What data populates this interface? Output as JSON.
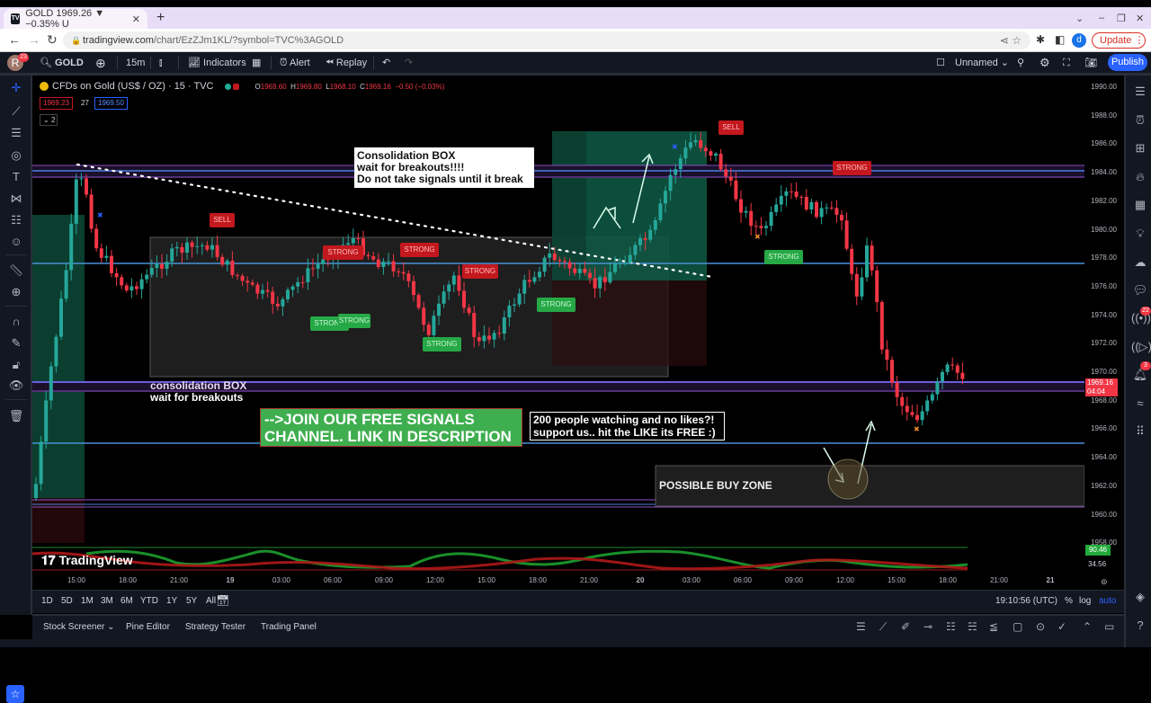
{
  "browser": {
    "tab_title": "GOLD 1969.26 ▼ −0.35% U",
    "tab_favicon": "TV",
    "url_domain": "tradingview.com",
    "url_path": "/chart/EzZJm1KL/?symbol=TVC%3AGOLD",
    "profile_initial": "d",
    "update_label": "Update"
  },
  "toolbar": {
    "avatar_initial": "R",
    "avatar_badge": "23",
    "symbol": "GOLD",
    "interval": "15m",
    "indicators_label": "Indicators",
    "alert_label": "Alert",
    "replay_label": "Replay",
    "layout_name": "Unnamed",
    "publish_label": "Publish"
  },
  "legend": {
    "title": "CFDs on Gold (US$ / OZ) · 15 · TVC",
    "open_label": "O",
    "open": "1969.60",
    "high_label": "H",
    "high": "1969.80",
    "low_label": "L",
    "low": "1968.10",
    "close_label": "C",
    "close": "1969.16",
    "change": "−0.50 (−0.03%)",
    "bid": "1969.23",
    "spread": "27",
    "ask": "1969.50",
    "indicators_toggle": "2"
  },
  "price_scale": {
    "ticks": [
      "1990.00",
      "1988.00",
      "1986.00",
      "1984.00",
      "1982.00",
      "1980.00",
      "1978.00",
      "1976.00",
      "1974.00",
      "1972.00",
      "1970.00",
      "1968.00",
      "1966.00",
      "1964.00",
      "1962.00",
      "1960.00",
      "1958.00"
    ],
    "current_price": "1969.16",
    "countdown": "04:04",
    "osc_value_1": "90.46",
    "osc_value_2": "34.56"
  },
  "time_axis": {
    "ticks": [
      "15:00",
      "18:00",
      "21:00",
      "19",
      "03:00",
      "06:00",
      "09:00",
      "12:00",
      "15:00",
      "18:00",
      "21:00",
      "20",
      "03:00",
      "06:00",
      "09:00",
      "12:00",
      "15:00",
      "18:00",
      "21:00",
      "21"
    ]
  },
  "range_bar": {
    "ranges": [
      "1D",
      "5D",
      "1M",
      "3M",
      "6M",
      "YTD",
      "1Y",
      "5Y",
      "All"
    ],
    "clock": "19:10:56 (UTC)",
    "percent": "%",
    "log": "log",
    "auto": "auto"
  },
  "bottom_panel": {
    "tabs": [
      "Stock Screener",
      "Pine Editor",
      "Strategy Tester",
      "Trading Panel"
    ]
  },
  "right_toolbar": {
    "badge_ideas": "22",
    "badge_alerts": "3"
  },
  "annotations": {
    "box_note_line1": "Consolidation BOX",
    "box_note_line2": "wait for breakouts!!!!",
    "box_note_line3": "Do not take signals until it break",
    "cons_label_line1": "consolidation BOX",
    "cons_label_line2": "wait for breakouts",
    "join_line1": "-->JOIN OUR FREE SIGNALS",
    "join_line2": "CHANNEL. LINK IN DESCRIPTION",
    "likes_line1": "200 people watching and no likes?!",
    "likes_line2": "support us.. hit the LIKE its FREE :)",
    "buy_zone": "POSSIBLE BUY ZONE"
  },
  "signals": [
    {
      "label": "SELL",
      "type": "sell"
    },
    {
      "label": "STRONG",
      "type": "sell"
    },
    {
      "label": "STRONG",
      "type": "sell"
    },
    {
      "label": "STRONG",
      "type": "sell"
    },
    {
      "label": "STRONG",
      "type": "buy"
    },
    {
      "label": "STRONG",
      "type": "buy"
    },
    {
      "label": "STRONG",
      "type": "buy"
    },
    {
      "label": "STRONG",
      "type": "buy"
    },
    {
      "label": "SELL",
      "type": "sell"
    },
    {
      "label": "STRONG",
      "type": "sell"
    },
    {
      "label": "STRONG",
      "type": "buy"
    }
  ],
  "watermark": "TradingView",
  "colors": {
    "up": "#26a69a",
    "down": "#f23645",
    "accent": "#2962ff"
  }
}
